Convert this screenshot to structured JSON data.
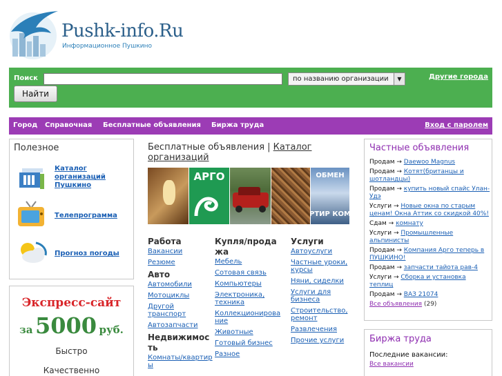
{
  "header": {
    "brand": "Pushk-info.Ru",
    "tagline": "Информационное Пушкино"
  },
  "search": {
    "label": "Поиск",
    "value": "",
    "mode_selected": "по названию организации",
    "button": "Найти",
    "other_cities": "Другие города"
  },
  "nav": {
    "items": [
      "Город",
      "Справочная",
      "Бесплатные объявления",
      "Биржа труда"
    ],
    "login": "Вход с паролем"
  },
  "useful": {
    "title": "Полезное",
    "links": [
      "Каталог организаций Пушкино",
      "Телепрограмма",
      "Прогноз погоды"
    ]
  },
  "express": {
    "title": "Экспресс-сайт",
    "price_prefix": "за",
    "price": "5000",
    "price_suffix": "руб.",
    "line1": "Быстро",
    "line2": "Качественно"
  },
  "ads": {
    "title_prefix": "Бесплатные объявления | ",
    "title_link": "Каталог организаций",
    "photo_texts": [
      "АРГО",
      "ОБМЕН",
      "РТИР КОМ"
    ],
    "columns": [
      {
        "groups": [
          {
            "title": "Работа",
            "links": [
              "Вакансии",
              "Резюме"
            ]
          },
          {
            "title": "Авто",
            "links": [
              "Автомобили",
              "Мотоциклы",
              "Другой транспорт",
              "Автозапчасти"
            ]
          },
          {
            "title": "Недвижимость",
            "links": [
              "Комнаты/квартиры"
            ]
          }
        ]
      },
      {
        "groups": [
          {
            "title": "Купля/продажа",
            "links": [
              "Мебель",
              "Сотовая связь",
              "Компьютеры",
              "Электроника, техника",
              "Коллекционирование",
              "Животные",
              "Готовый бизнес",
              "Разное"
            ]
          }
        ]
      },
      {
        "groups": [
          {
            "title": "Услуги",
            "links": [
              "Автоуслуги",
              "Частные уроки, курсы",
              "Няни, сиделки",
              "Услуги для бизнеса",
              "Строительство, ремонт",
              "Развлечения",
              "Прочие услуги"
            ]
          }
        ]
      }
    ]
  },
  "private_ads": {
    "title": "Частные объявления",
    "items": [
      {
        "type": "Продам",
        "text": "Daewoo Magnus"
      },
      {
        "type": "Продам",
        "text": "Котят(британцы и шотландцы)"
      },
      {
        "type": "Продам",
        "text": "купить новый спайс Улан-Удэ"
      },
      {
        "type": "Услуги",
        "text": "Новые окна по старым ценам! Окна Аттик со скидкой 40%!"
      },
      {
        "type": "Сдам",
        "text": "комнату"
      },
      {
        "type": "Услуги",
        "text": "Промышленные альпинисты"
      },
      {
        "type": "Продам",
        "text": "Компания Арго теперь в ПУШКИНО!"
      },
      {
        "type": "Продам",
        "text": "запчасти тайота рав-4"
      },
      {
        "type": "Услуги",
        "text": "Сборка и установка теплиц"
      },
      {
        "type": "Продам",
        "text": "ВАЗ 21074"
      }
    ],
    "all_link": "Все объявления",
    "all_count": "(29)"
  },
  "jobs": {
    "title": "Биржа труда",
    "subtitle": "Последние вакансии:",
    "all_link": "Все вакансии"
  },
  "colors": {
    "green_bar": "#4caf50",
    "purple_bar": "#9c3cb5",
    "link": "#1a5fb4",
    "express_red": "#d9262a",
    "express_green": "#3a8a3e"
  }
}
